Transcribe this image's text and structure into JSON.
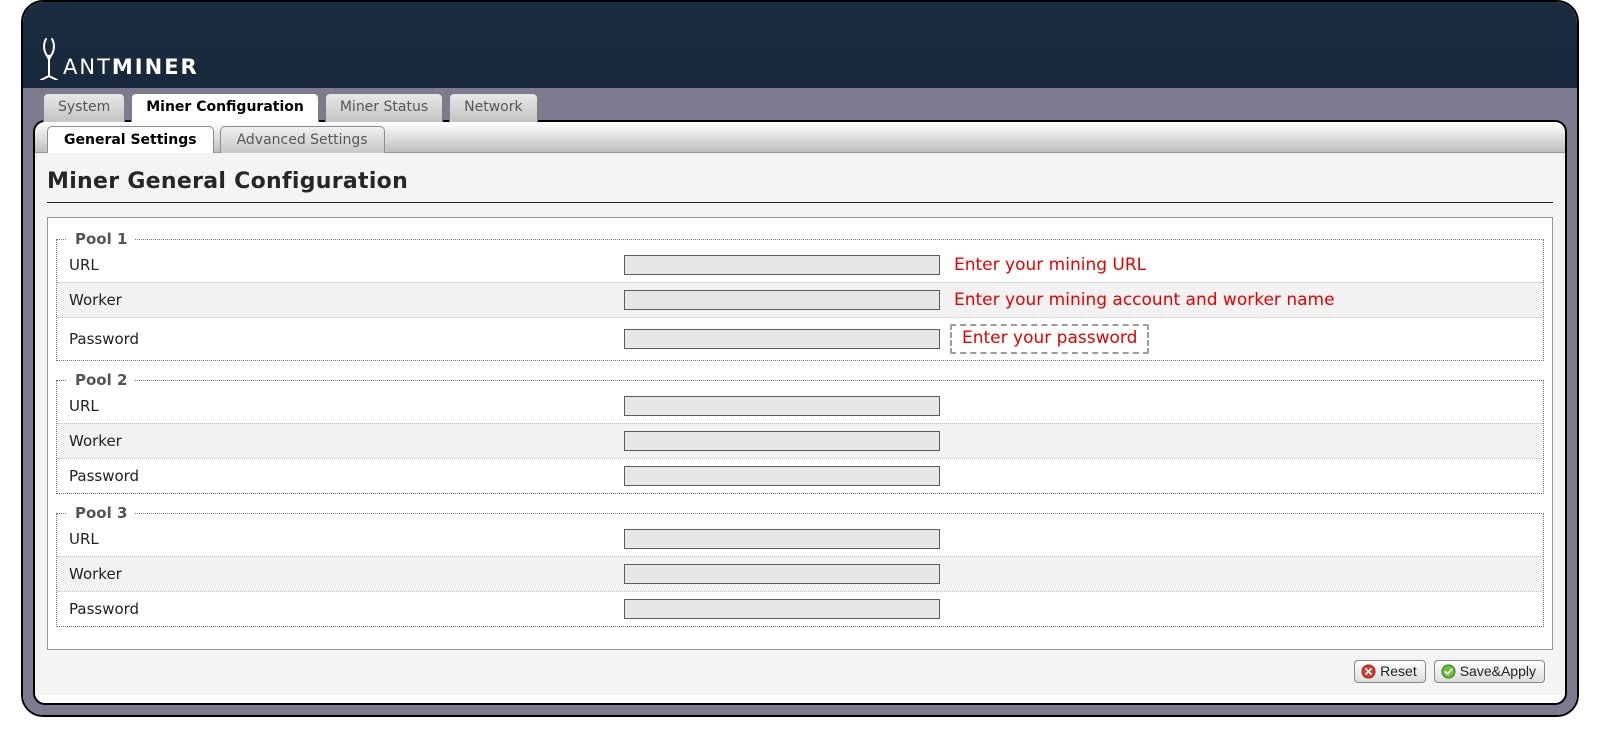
{
  "brand": {
    "thin": "ANT",
    "bold": "MINER"
  },
  "main_tabs": [
    {
      "label": "System",
      "active": false
    },
    {
      "label": "Miner Configuration",
      "active": true
    },
    {
      "label": "Miner Status",
      "active": false
    },
    {
      "label": "Network",
      "active": false
    }
  ],
  "sub_tabs": [
    {
      "label": "General Settings",
      "active": true
    },
    {
      "label": "Advanced Settings",
      "active": false
    }
  ],
  "page_title": "Miner General Configuration",
  "pools": [
    {
      "legend": "Pool 1",
      "rows": [
        {
          "label": "URL",
          "value": "",
          "hint": "Enter your mining URL",
          "boxed": false,
          "alt": false
        },
        {
          "label": "Worker",
          "value": "",
          "hint": "Enter your mining account and worker name",
          "boxed": false,
          "alt": true
        },
        {
          "label": "Password",
          "value": "",
          "hint": "Enter your password",
          "boxed": true,
          "alt": false
        }
      ]
    },
    {
      "legend": "Pool 2",
      "rows": [
        {
          "label": "URL",
          "value": "",
          "hint": "",
          "alt": false
        },
        {
          "label": "Worker",
          "value": "",
          "hint": "",
          "alt": true
        },
        {
          "label": "Password",
          "value": "",
          "hint": "",
          "alt": false
        }
      ]
    },
    {
      "legend": "Pool 3",
      "rows": [
        {
          "label": "URL",
          "value": "",
          "hint": "",
          "alt": false
        },
        {
          "label": "Worker",
          "value": "",
          "hint": "",
          "alt": true
        },
        {
          "label": "Password",
          "value": "",
          "hint": "",
          "alt": false
        }
      ]
    }
  ],
  "buttons": {
    "reset": "Reset",
    "save": "Save&Apply"
  },
  "colors": {
    "hint": "#e60000",
    "frame": "#7f7a8f",
    "banner": "#1a2a3d"
  }
}
